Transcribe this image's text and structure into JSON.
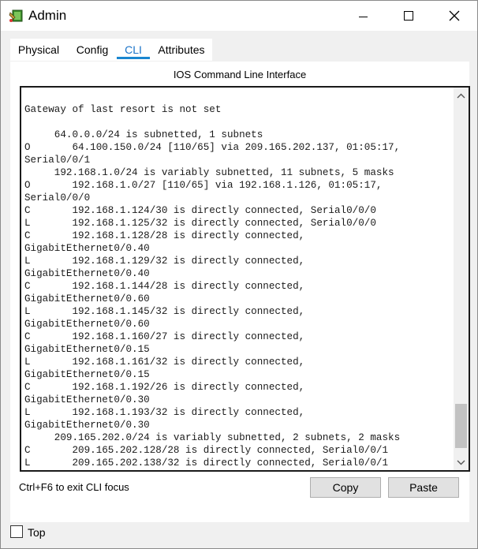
{
  "window": {
    "title": "Admin",
    "icon": "router-icon"
  },
  "tabs": [
    {
      "label": "Physical",
      "active": false
    },
    {
      "label": "Config",
      "active": false
    },
    {
      "label": "CLI",
      "active": true
    },
    {
      "label": "Attributes",
      "active": false
    }
  ],
  "cli": {
    "heading": "IOS Command Line Interface",
    "console_text": "\nGateway of last resort is not set\n\n     64.0.0.0/24 is subnetted, 1 subnets\nO       64.100.150.0/24 [110/65] via 209.165.202.137, 01:05:17,\nSerial0/0/1\n     192.168.1.0/24 is variably subnetted, 11 subnets, 5 masks\nO       192.168.1.0/27 [110/65] via 192.168.1.126, 01:05:17,\nSerial0/0/0\nC       192.168.1.124/30 is directly connected, Serial0/0/0\nL       192.168.1.125/32 is directly connected, Serial0/0/0\nC       192.168.1.128/28 is directly connected,\nGigabitEthernet0/0.40\nL       192.168.1.129/32 is directly connected,\nGigabitEthernet0/0.40\nC       192.168.1.144/28 is directly connected,\nGigabitEthernet0/0.60\nL       192.168.1.145/32 is directly connected,\nGigabitEthernet0/0.60\nC       192.168.1.160/27 is directly connected,\nGigabitEthernet0/0.15\nL       192.168.1.161/32 is directly connected,\nGigabitEthernet0/0.15\nC       192.168.1.192/26 is directly connected,\nGigabitEthernet0/0.30\nL       192.168.1.193/32 is directly connected,\nGigabitEthernet0/0.30\n     209.165.202.0/24 is variably subnetted, 2 subnets, 2 masks\nC       209.165.202.128/28 is directly connected, Serial0/0/1\nL       209.165.202.138/32 is directly connected, Serial0/0/1",
    "hint": "Ctrl+F6 to exit CLI focus",
    "copy_label": "Copy",
    "paste_label": "Paste"
  },
  "footer": {
    "top_label": "Top",
    "top_checked": false
  },
  "colors": {
    "accent": "#1a86d0",
    "console_border": "#1a1a1a"
  }
}
